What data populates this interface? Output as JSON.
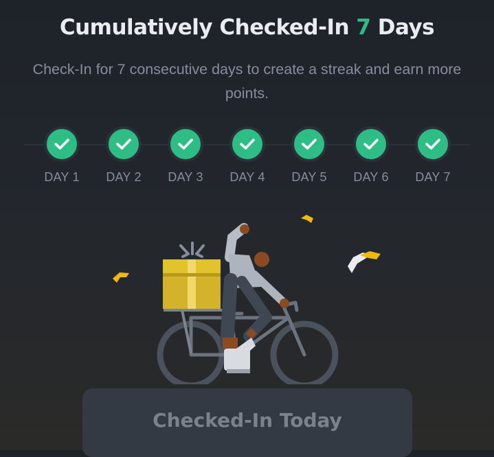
{
  "header": {
    "title_prefix": "Cumulatively Checked-In ",
    "title_count": "7",
    "title_suffix": " Days",
    "subtitle": "Check-In for 7 consecutive days to create a streak and earn more points."
  },
  "streak": {
    "days": [
      {
        "label": "DAY 1",
        "checked": true
      },
      {
        "label": "DAY 2",
        "checked": true
      },
      {
        "label": "DAY 3",
        "checked": true
      },
      {
        "label": "DAY 4",
        "checked": true
      },
      {
        "label": "DAY 5",
        "checked": true
      },
      {
        "label": "DAY 6",
        "checked": true
      },
      {
        "label": "DAY 7",
        "checked": true
      }
    ]
  },
  "illustration": {
    "description_icon": "cyclist-with-gift-illustration"
  },
  "action": {
    "label": "Checked-In Today",
    "state": "disabled"
  },
  "colors": {
    "accent": "#2ebd85",
    "background": "#1e2329",
    "muted_text": "#848e9c",
    "button_bg": "#343a44",
    "gift": "#e2c32b",
    "confetti": "#f0b90b"
  }
}
